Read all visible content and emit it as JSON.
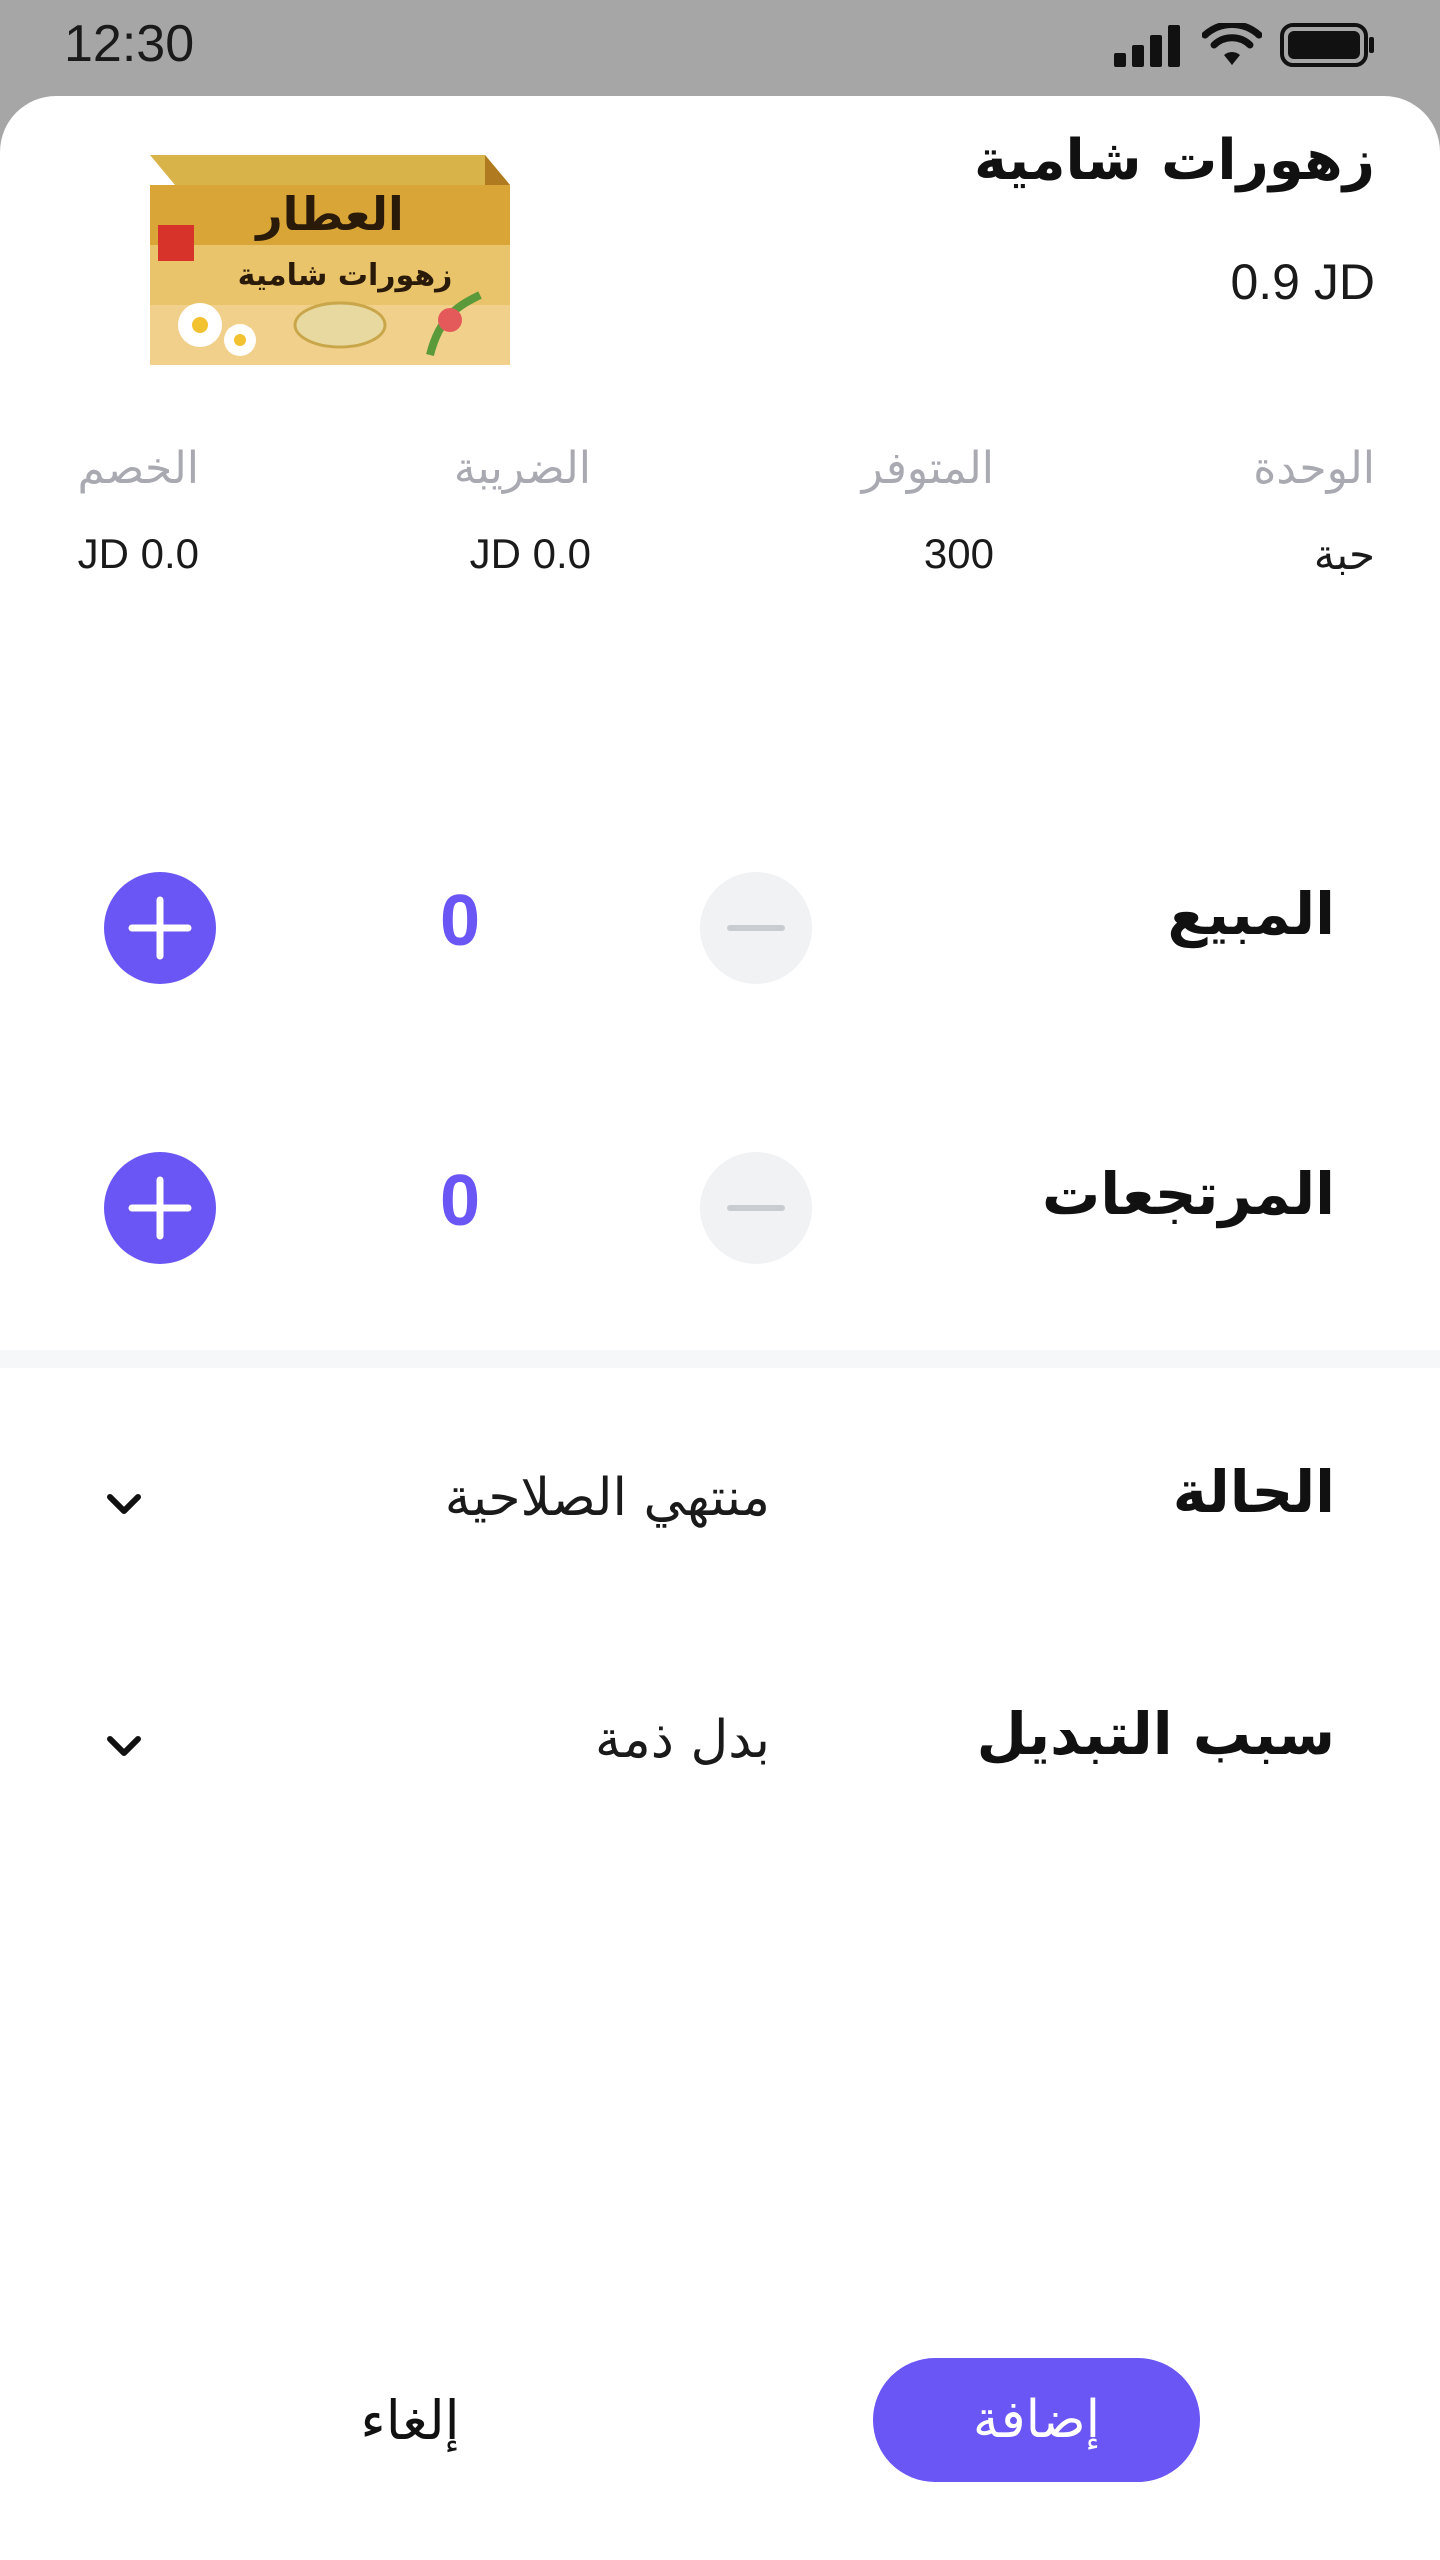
{
  "status_bar": {
    "time": "12:30"
  },
  "product": {
    "name": "زهورات شامية",
    "price": "0.9 JD",
    "image_brand": "العطار",
    "image_product": "زهورات شامية"
  },
  "info": {
    "unit": {
      "label": "الوحدة",
      "value": "حبة"
    },
    "available": {
      "label": "المتوفر",
      "value": "300"
    },
    "tax": {
      "label": "الضريبة",
      "value": "0.0 JD"
    },
    "discount": {
      "label": "الخصم",
      "value": "0.0 JD"
    }
  },
  "sales": {
    "label": "المبيع",
    "count": "0"
  },
  "returns": {
    "label": "المرتجعات",
    "count": "0"
  },
  "status": {
    "label": "الحالة",
    "value": "منتهي الصلاحية"
  },
  "reason": {
    "label": "سبب التبديل",
    "value": "بدل ذمة"
  },
  "actions": {
    "add": "إضافة",
    "cancel": "إلغاء"
  },
  "colors": {
    "accent": "#6a55f5",
    "muted": "#a9a9b2",
    "minus_bg": "#f0f2f4"
  },
  "icons": [
    "signal-icon",
    "wifi-icon",
    "battery-icon",
    "plus-icon",
    "minus-icon",
    "chevron-down-icon"
  ]
}
